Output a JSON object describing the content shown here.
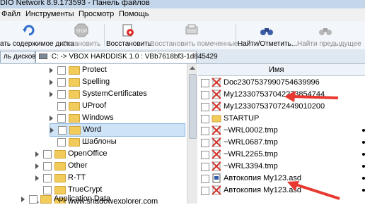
{
  "window": {
    "title": "DIO Network 8.9.173593 - Панель файлов"
  },
  "menu": [
    "Файл",
    "Инструменты",
    "Просмотр",
    "Помощь"
  ],
  "toolbar": {
    "scan": "ать содержимое диска",
    "stop": "Остановить",
    "restore": "Восстановить",
    "restore_marked": "Восстановить помеченные...",
    "find_mark": "Найти/Отметить...",
    "find_prev": "Найти предыдущее"
  },
  "tabs": {
    "disks": "ль дисков",
    "path": "C: -> VBOX HARDDISK 1.0 : VBb7618bf3-1d845429"
  },
  "tree": [
    {
      "label": "Protect"
    },
    {
      "label": "Spelling"
    },
    {
      "label": "SystemCertificates"
    },
    {
      "label": "UProof"
    },
    {
      "label": "Windows"
    },
    {
      "label": "Word"
    },
    {
      "label": "Шаблоны"
    },
    {
      "label": "OpenOffice"
    },
    {
      "label": "Other"
    },
    {
      "label": "R-TT"
    },
    {
      "label": "TrueCrypt"
    },
    {
      "label": "www.shadowexplorer.com"
    },
    {
      "label": "Application Data"
    }
  ],
  "files": {
    "header": "Имя",
    "rows": [
      {
        "name": "Doc2307537990754639996",
        "icon": "deleted-x-icon"
      },
      {
        "name": "My12330753704227385474​4",
        "icon": "deleted-x-icon"
      },
      {
        "name": "My12330753707244901020​0",
        "icon": "deleted-x-icon"
      },
      {
        "name": "STARTUP",
        "icon": "folder-icon"
      },
      {
        "name": "~WRL0002.tmp",
        "icon": "deleted-x-icon"
      },
      {
        "name": "~WRL0687.tmp",
        "icon": "deleted-x-icon"
      },
      {
        "name": "~WRL2265.tmp",
        "icon": "deleted-x-icon"
      },
      {
        "name": "~WRL3394.tmp",
        "icon": "deleted-x-icon"
      },
      {
        "name": "Автокопия My123.asd",
        "icon": "doc-icon"
      },
      {
        "name": "Автокопия My123.asd",
        "icon": "deleted-x-icon"
      }
    ]
  },
  "colors": {
    "accent": "#e8382f",
    "selection": "#cfe3f7"
  }
}
